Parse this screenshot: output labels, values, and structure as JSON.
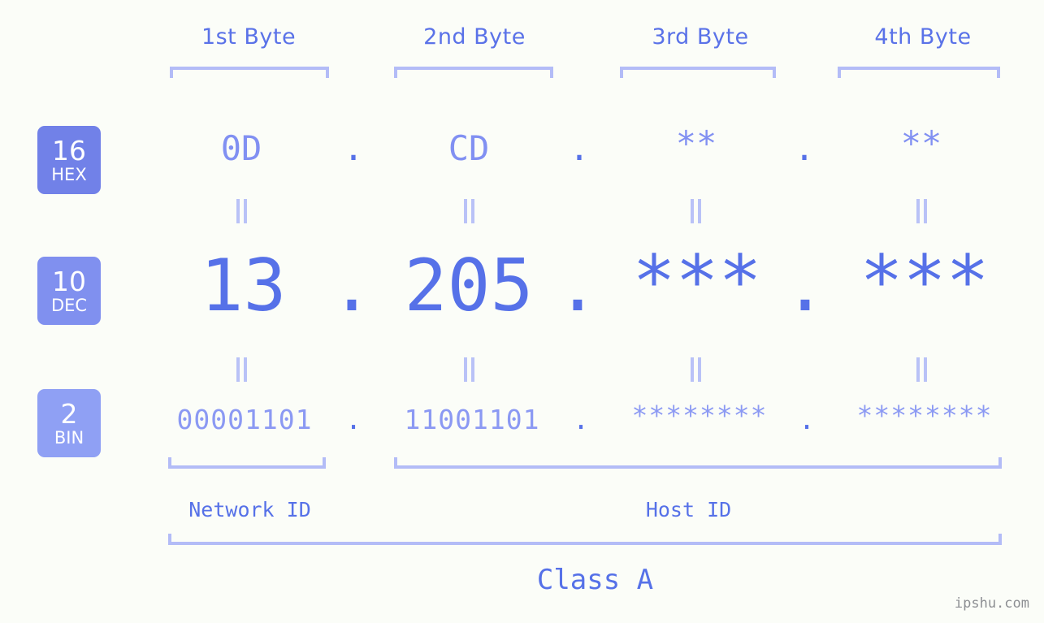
{
  "page": {
    "background_color": "#fbfdf8",
    "accent_primary": "#5671e8",
    "accent_light": "#8b99f3",
    "bracket_color": "#b3bcf7",
    "watermark": "ipshu.com"
  },
  "headers": [
    {
      "label": "1st Byte"
    },
    {
      "label": "2nd Byte"
    },
    {
      "label": "3rd Byte"
    },
    {
      "label": "4th Byte"
    }
  ],
  "bases": [
    {
      "num": "16",
      "abbr": "HEX",
      "color": "#7181e8"
    },
    {
      "num": "10",
      "abbr": "DEC",
      "color": "#8090ef"
    },
    {
      "num": "2",
      "abbr": "BIN",
      "color": "#8fa0f4"
    }
  ],
  "separator": ".",
  "equals_symbol": "||",
  "rows": {
    "hex": {
      "values": [
        "0D",
        "CD",
        "**",
        "**"
      ]
    },
    "dec": {
      "values": [
        "13",
        "205",
        "***",
        "***"
      ]
    },
    "bin": {
      "values": [
        "00001101",
        "11001101",
        "********",
        "********"
      ]
    }
  },
  "sections": {
    "network_id": "Network ID",
    "host_id": "Host ID",
    "class": "Class A"
  }
}
